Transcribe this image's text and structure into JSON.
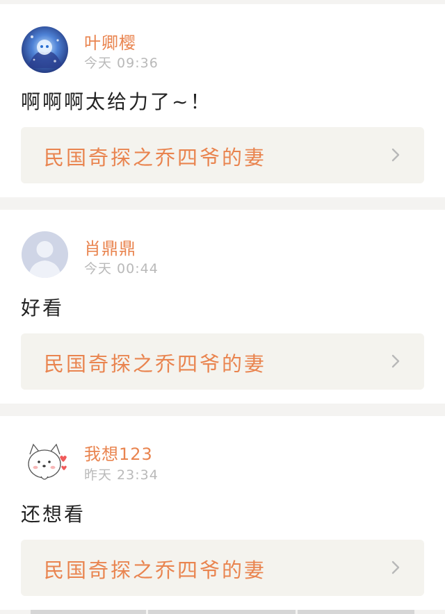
{
  "comments": [
    {
      "username": "叶卿樱",
      "time": "今天 09:36",
      "text": "啊啊啊太给力了~！",
      "book_title": "民国奇探之乔四爷的妻",
      "avatar": "anime-girl-avatar"
    },
    {
      "username": "肖鼎鼎",
      "time": "今天 00:44",
      "text": "好看",
      "book_title": "民国奇探之乔四爷的妻",
      "avatar": "default-user-avatar"
    },
    {
      "username": "我想123",
      "time": "昨天 23:34",
      "text": "还想看",
      "book_title": "民国奇探之乔四爷的妻",
      "avatar": "cartoon-dog-avatar"
    }
  ],
  "colors": {
    "accent": "#e9844f",
    "comment_text": "#222222",
    "muted": "#b9b9b9",
    "link_bg": "#f4f3ee",
    "page_bg": "#f4f3f1"
  },
  "icons": {
    "chevron": "chevron-right-icon"
  }
}
